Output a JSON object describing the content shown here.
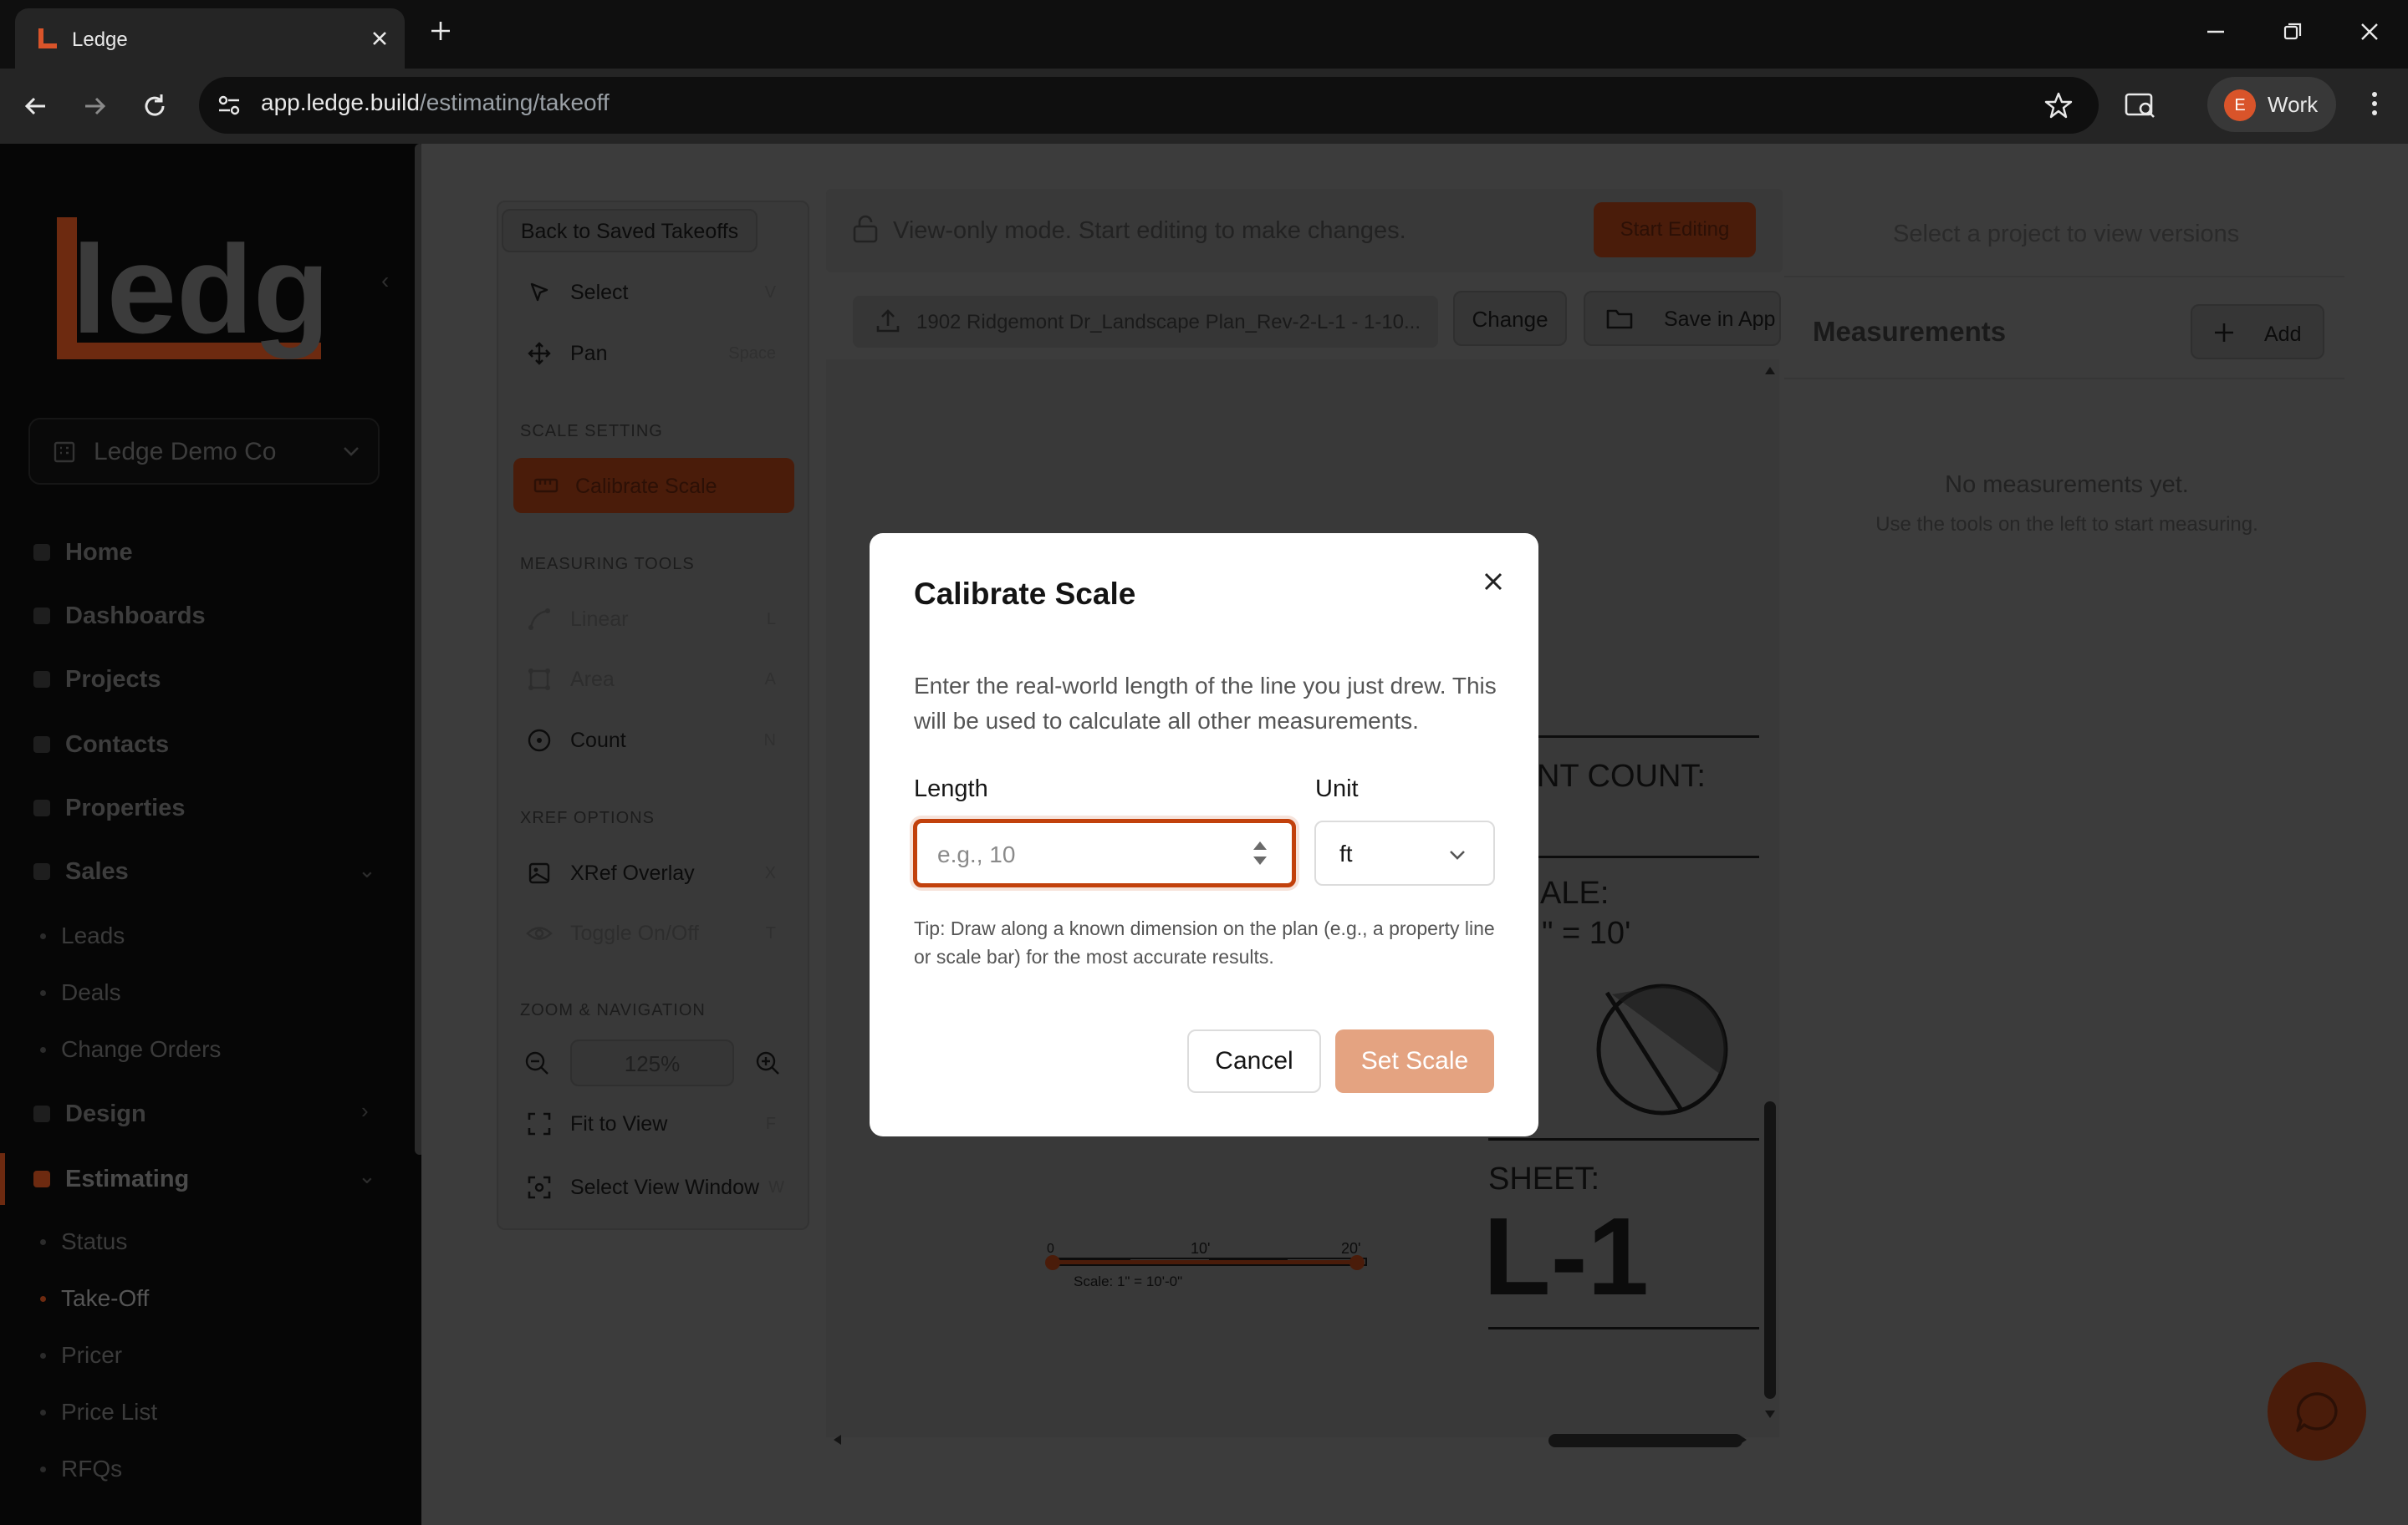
{
  "browser": {
    "tab_title": "Ledge",
    "url_host": "app.ledge.build",
    "url_path": "/estimating/takeoff",
    "profile_initial": "E",
    "profile_label": "Work"
  },
  "sidebar": {
    "logo_text": "ledge",
    "org_name": "Ledge Demo Co",
    "nav": [
      {
        "label": "Home"
      },
      {
        "label": "Dashboards"
      },
      {
        "label": "Projects"
      },
      {
        "label": "Contacts"
      },
      {
        "label": "Properties"
      },
      {
        "label": "Sales"
      },
      {
        "label": "Design"
      },
      {
        "label": "Estimating"
      }
    ],
    "sales_sub": [
      {
        "label": "Leads"
      },
      {
        "label": "Deals"
      },
      {
        "label": "Change Orders"
      }
    ],
    "estimating_sub": [
      {
        "label": "Status"
      },
      {
        "label": "Take-Off"
      },
      {
        "label": "Pricer"
      },
      {
        "label": "Price List"
      },
      {
        "label": "RFQs"
      }
    ]
  },
  "tools": {
    "back_label": "Back to Saved Takeoffs",
    "select": {
      "label": "Select",
      "key": "V"
    },
    "pan": {
      "label": "Pan",
      "key": "Space"
    },
    "scale_section": "SCALE SETTING",
    "calibrate_label": "Calibrate Scale",
    "measuring_section": "MEASURING TOOLS",
    "linear": {
      "label": "Linear",
      "key": "L"
    },
    "area": {
      "label": "Area",
      "key": "A"
    },
    "count": {
      "label": "Count",
      "key": "N"
    },
    "xref_section": "XREF OPTIONS",
    "xref_overlay": {
      "label": "XRef Overlay",
      "key": "X"
    },
    "toggle": {
      "label": "Toggle On/Off",
      "key": "T"
    },
    "zoom_section": "ZOOM & NAVIGATION",
    "zoom_value": "125%",
    "fit": {
      "label": "Fit to View",
      "key": "F"
    },
    "view_window": {
      "label": "Select View Window",
      "key": "W"
    }
  },
  "viewer": {
    "view_only_text": "View-only mode. Start editing to make changes.",
    "start_editing_label": "Start Editing",
    "file_name": "1902 Ridgemont Dr_Landscape Plan_Rev-2-L-1 - 1-10...",
    "change_label": "Change",
    "save_label": "Save in App",
    "plan": {
      "count_text": "NT COUNT:",
      "scale_label": "ALE:",
      "scale_value": "\" = 10'",
      "sheet_label": "SHEET:",
      "sheet_number": "L-1",
      "bar_0": "0",
      "bar_10": "10'",
      "bar_20": "20'",
      "bar_caption": "Scale: 1\" = 10'-0\""
    }
  },
  "right_panel": {
    "versions_text": "Select a project to view versions",
    "title": "Measurements",
    "add_label": "Add",
    "empty_title": "No measurements yet.",
    "empty_desc": "Use the tools on the left to start measuring."
  },
  "modal": {
    "title": "Calibrate Scale",
    "description": "Enter the real-world length of the line you just drew. This will be used to calculate all other measurements.",
    "length_label": "Length",
    "length_placeholder": "e.g., 10",
    "unit_label": "Unit",
    "unit_value": "ft",
    "tip": "Tip: Draw along a known dimension on the plan (e.g., a property line or scale bar) for the most accurate results.",
    "cancel_label": "Cancel",
    "set_scale_label": "Set Scale"
  },
  "colors": {
    "accent": "#c2410c",
    "set_scale_disabled": "#e4a381"
  }
}
